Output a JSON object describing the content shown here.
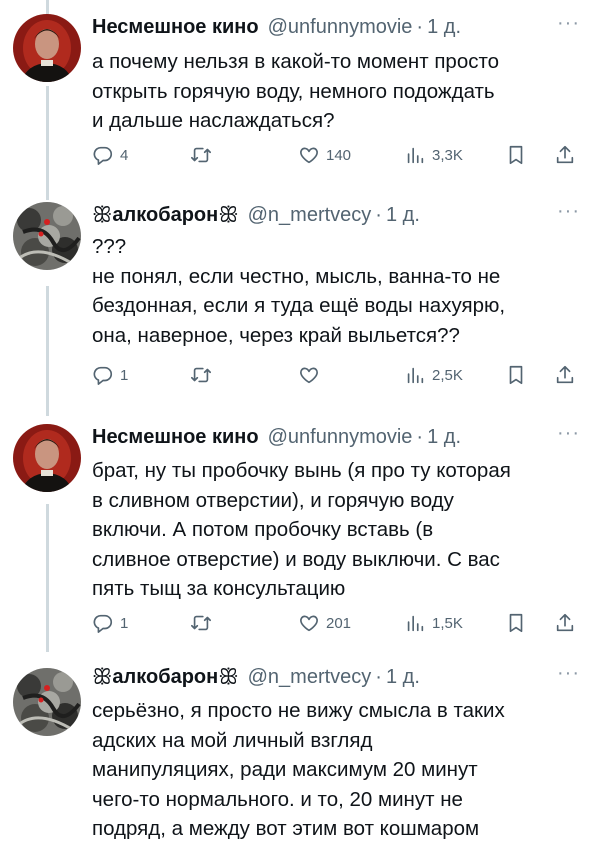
{
  "tweets": [
    {
      "name": "Несмешное кино",
      "handle": "@unfunnymovie",
      "dot": "·",
      "time": "1 д.",
      "text": "а почему нельзя в какой-то момент просто\nоткрыть горячую воду, немного подождать\nи дальше наслаждаться?",
      "stats": {
        "replies": "4",
        "retweets": "",
        "likes": "140",
        "views": "3,3K"
      }
    },
    {
      "name": "алкобарон",
      "name_glyph": "ꕥ",
      "handle": "@n_mertvecy",
      "dot": "·",
      "time": "1 д.",
      "text": "???\nне понял, если честно, мысль, ванна-то не\nбездонная, если я туда ещё воды нахуярю,\nона, наверное, через край выльется??",
      "stats": {
        "replies": "1",
        "retweets": "",
        "likes": "",
        "views": "2,5K"
      }
    },
    {
      "name": "Несмешное кино",
      "handle": "@unfunnymovie",
      "dot": "·",
      "time": "1 д.",
      "text": "брат, ну ты пробочку вынь (я про ту которая\nв сливном отверстии), и горячую воду\nвключи. А потом пробочку вставь (в\nсливное отверстие) и воду выключи. С вас\nпять тыщ за консультацию",
      "stats": {
        "replies": "1",
        "retweets": "",
        "likes": "201",
        "views": "1,5K"
      }
    },
    {
      "name": "алкобарон",
      "name_glyph": "ꕥ",
      "handle": "@n_mertvecy",
      "dot": "·",
      "time": "1 д.",
      "text": "серьёзно, я просто не вижу смысла в таких\nадских на мой личный взгляд\nманипуляциях, ради максимум 20 минут\nчего-то нормального. и то, 20 минут не\nподряд, а между вот этим вот кошмаром",
      "stats": {}
    }
  ],
  "more_glyph": "···",
  "colors": {
    "text": "#0f1419",
    "secondary": "#536471",
    "thread_line": "#cfd9de"
  }
}
